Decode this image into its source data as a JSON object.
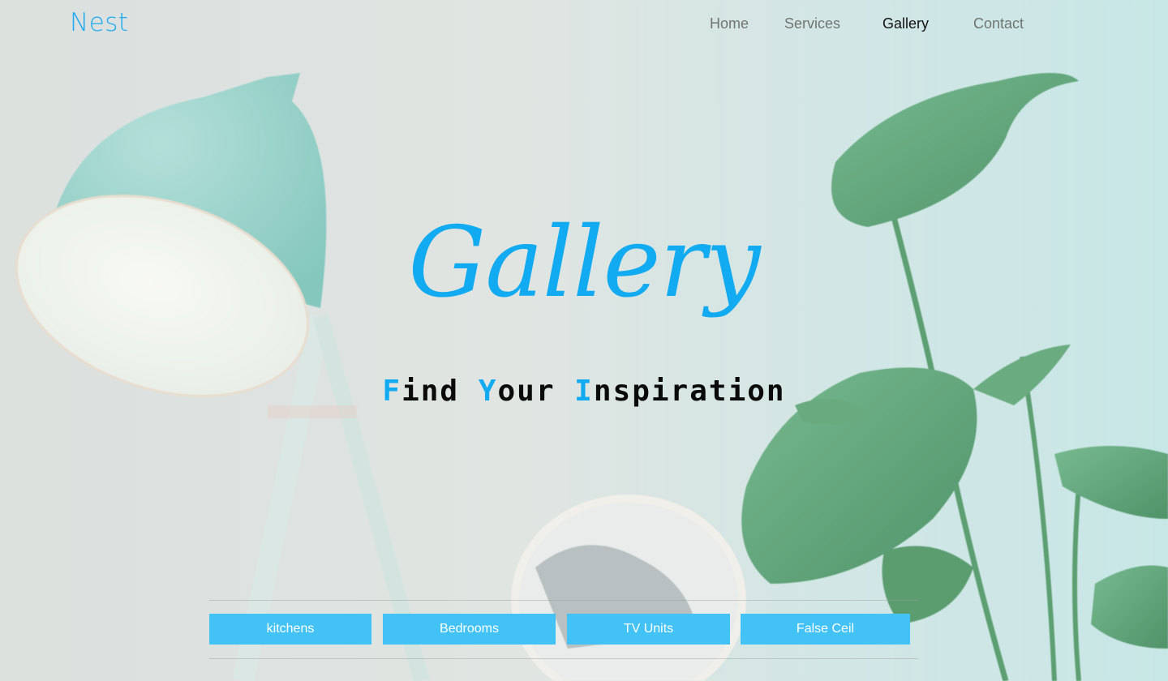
{
  "brand": {
    "name": "Nest"
  },
  "nav": {
    "items": [
      {
        "label": "Home",
        "active": false
      },
      {
        "label": "Services",
        "active": false
      },
      {
        "label": "Gallery",
        "active": true
      },
      {
        "label": "Contact",
        "active": false
      }
    ]
  },
  "hero": {
    "title": "Gallery",
    "subtitle": {
      "words": [
        {
          "initial": "F",
          "rest": "ind "
        },
        {
          "initial": "Y",
          "rest": "our "
        },
        {
          "initial": "I",
          "rest": "nspiration"
        }
      ]
    }
  },
  "filters": {
    "buttons": [
      "kitchens",
      "Bedrooms",
      "TV Units",
      "False Ceil"
    ]
  },
  "colors": {
    "accent": "#12aaf0",
    "button": "#42c2f5",
    "nav_text": "#707573",
    "nav_active": "#111111"
  }
}
